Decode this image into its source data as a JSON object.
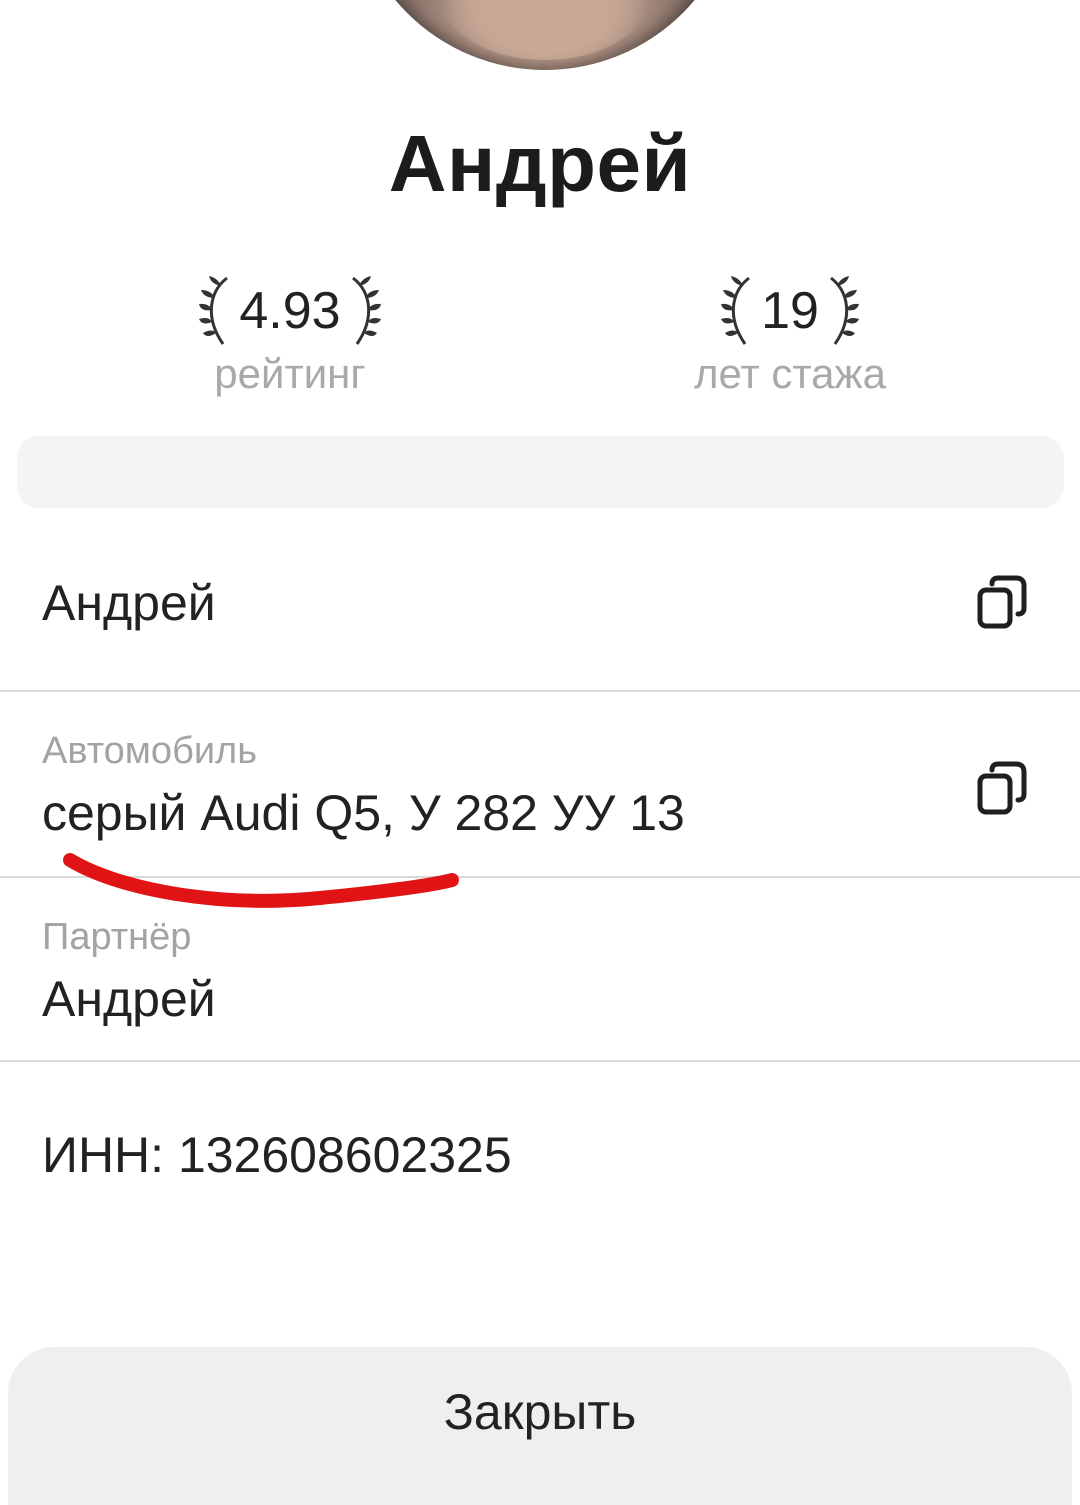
{
  "driver": {
    "name": "Андрей"
  },
  "stats": {
    "rating": {
      "value": "4.93",
      "caption": "рейтинг"
    },
    "experience": {
      "value": "19",
      "caption": "лет стажа"
    }
  },
  "details": {
    "driver_name": "Андрей",
    "car": {
      "label": "Автомобиль",
      "value": "серый Audi Q5, У 282 УУ 13"
    },
    "partner": {
      "label": "Партнёр",
      "value": "Андрей"
    },
    "inn": "ИНН: 132608602325"
  },
  "actions": {
    "close_label": "Закрыть"
  },
  "colors": {
    "annotation_underline": "#e01414",
    "secondary_text": "#a9a9a9",
    "banner_bg": "#f4f4f2",
    "button_bg": "#efefed"
  },
  "icons": {
    "copy": "copy-icon",
    "laurel": "laurel-wreath-icon"
  }
}
